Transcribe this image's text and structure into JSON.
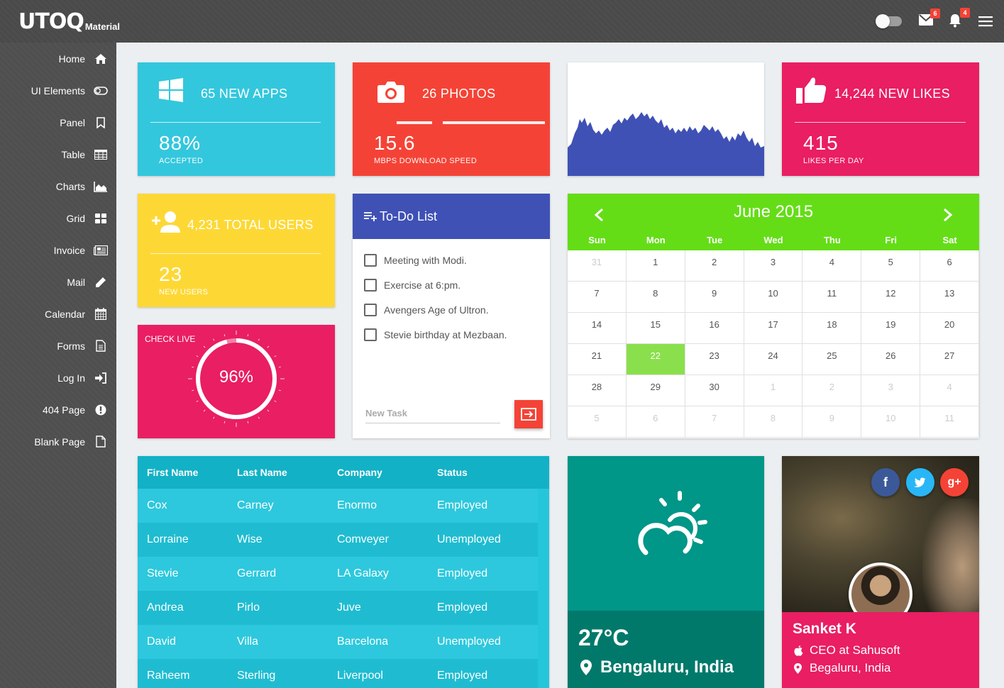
{
  "header": {
    "logo": "UTOQ",
    "logo_sub": "Material",
    "mail_count": "6",
    "notif_count": "4"
  },
  "sidebar": {
    "items": [
      {
        "label": "Home",
        "icon": "home-icon"
      },
      {
        "label": "UI Elements",
        "icon": "toggle-icon"
      },
      {
        "label": "Panel",
        "icon": "bookmark-icon"
      },
      {
        "label": "Table",
        "icon": "table-icon"
      },
      {
        "label": "Charts",
        "icon": "area-chart-icon"
      },
      {
        "label": "Grid",
        "icon": "grid-icon"
      },
      {
        "label": "Invoice",
        "icon": "newspaper-icon"
      },
      {
        "label": "Mail",
        "icon": "pencil-icon"
      },
      {
        "label": "Calendar",
        "icon": "calendar-icon"
      },
      {
        "label": "Forms",
        "icon": "file-text-icon"
      },
      {
        "label": "Log In",
        "icon": "sign-in-icon"
      },
      {
        "label": "404 Page",
        "icon": "exclamation-icon"
      },
      {
        "label": "Blank Page",
        "icon": "file-icon"
      }
    ]
  },
  "stats": {
    "apps": {
      "title": "65 NEW APPS",
      "value": "88%",
      "sub": "ACCEPTED",
      "color": "#33c7dd"
    },
    "photos": {
      "title": "26 PHOTOS",
      "value": "15.6",
      "sub": "MBPS DOWNLOAD SPEED",
      "color": "#f44336"
    },
    "likes": {
      "title": "14,244 NEW LIKES",
      "value": "415",
      "sub": "LIKES PER DAY",
      "color": "#e91e63"
    },
    "users": {
      "title": "4,231 TOTAL USERS",
      "value": "23",
      "sub": "NEW USERS",
      "color": "#fdd835"
    }
  },
  "live": {
    "label": "CHECK LIVE",
    "value": "96%",
    "percent": 0.96
  },
  "todo": {
    "title": "To-Do List",
    "items": [
      "Meeting with Modi.",
      "Exercise at 6:pm.",
      "Avengers Age of Ultron.",
      "Stevie birthday at Mezbaan."
    ],
    "new_task_placeholder": "New Task"
  },
  "calendar": {
    "title": "June 2015",
    "days": [
      "Sun",
      "Mon",
      "Tue",
      "Wed",
      "Thu",
      "Fri",
      "Sat"
    ],
    "weeks": [
      [
        "31",
        "1",
        "2",
        "3",
        "4",
        "5",
        "6"
      ],
      [
        "7",
        "8",
        "9",
        "10",
        "11",
        "12",
        "13"
      ],
      [
        "14",
        "15",
        "16",
        "17",
        "18",
        "19",
        "20"
      ],
      [
        "21",
        "22",
        "23",
        "24",
        "25",
        "26",
        "27"
      ],
      [
        "28",
        "29",
        "30",
        "1",
        "2",
        "3",
        "4"
      ],
      [
        "5",
        "6",
        "7",
        "8",
        "9",
        "10",
        "11"
      ]
    ],
    "today": "22"
  },
  "table": {
    "headers": [
      "First Name",
      "Last Name",
      "Company",
      "Status"
    ],
    "rows": [
      [
        "Cox",
        "Carney",
        "Enormo",
        "Employed"
      ],
      [
        "Lorraine",
        "Wise",
        "Comveyer",
        "Unemployed"
      ],
      [
        "Stevie",
        "Gerrard",
        "LA Galaxy",
        "Employed"
      ],
      [
        "Andrea",
        "Pirlo",
        "Juve",
        "Employed"
      ],
      [
        "David",
        "Villa",
        "Barcelona",
        "Unemployed"
      ],
      [
        "Raheem",
        "Sterling",
        "Liverpool",
        "Employed"
      ]
    ]
  },
  "weather": {
    "temp": "27°C",
    "location": "Bengaluru, India",
    "icon": "partly-cloudy-icon"
  },
  "profile": {
    "name": "Sanket K",
    "role": "CEO at Sahusoft",
    "location": "Begaluru, India",
    "facebook": "f",
    "googleplus": "g+"
  }
}
